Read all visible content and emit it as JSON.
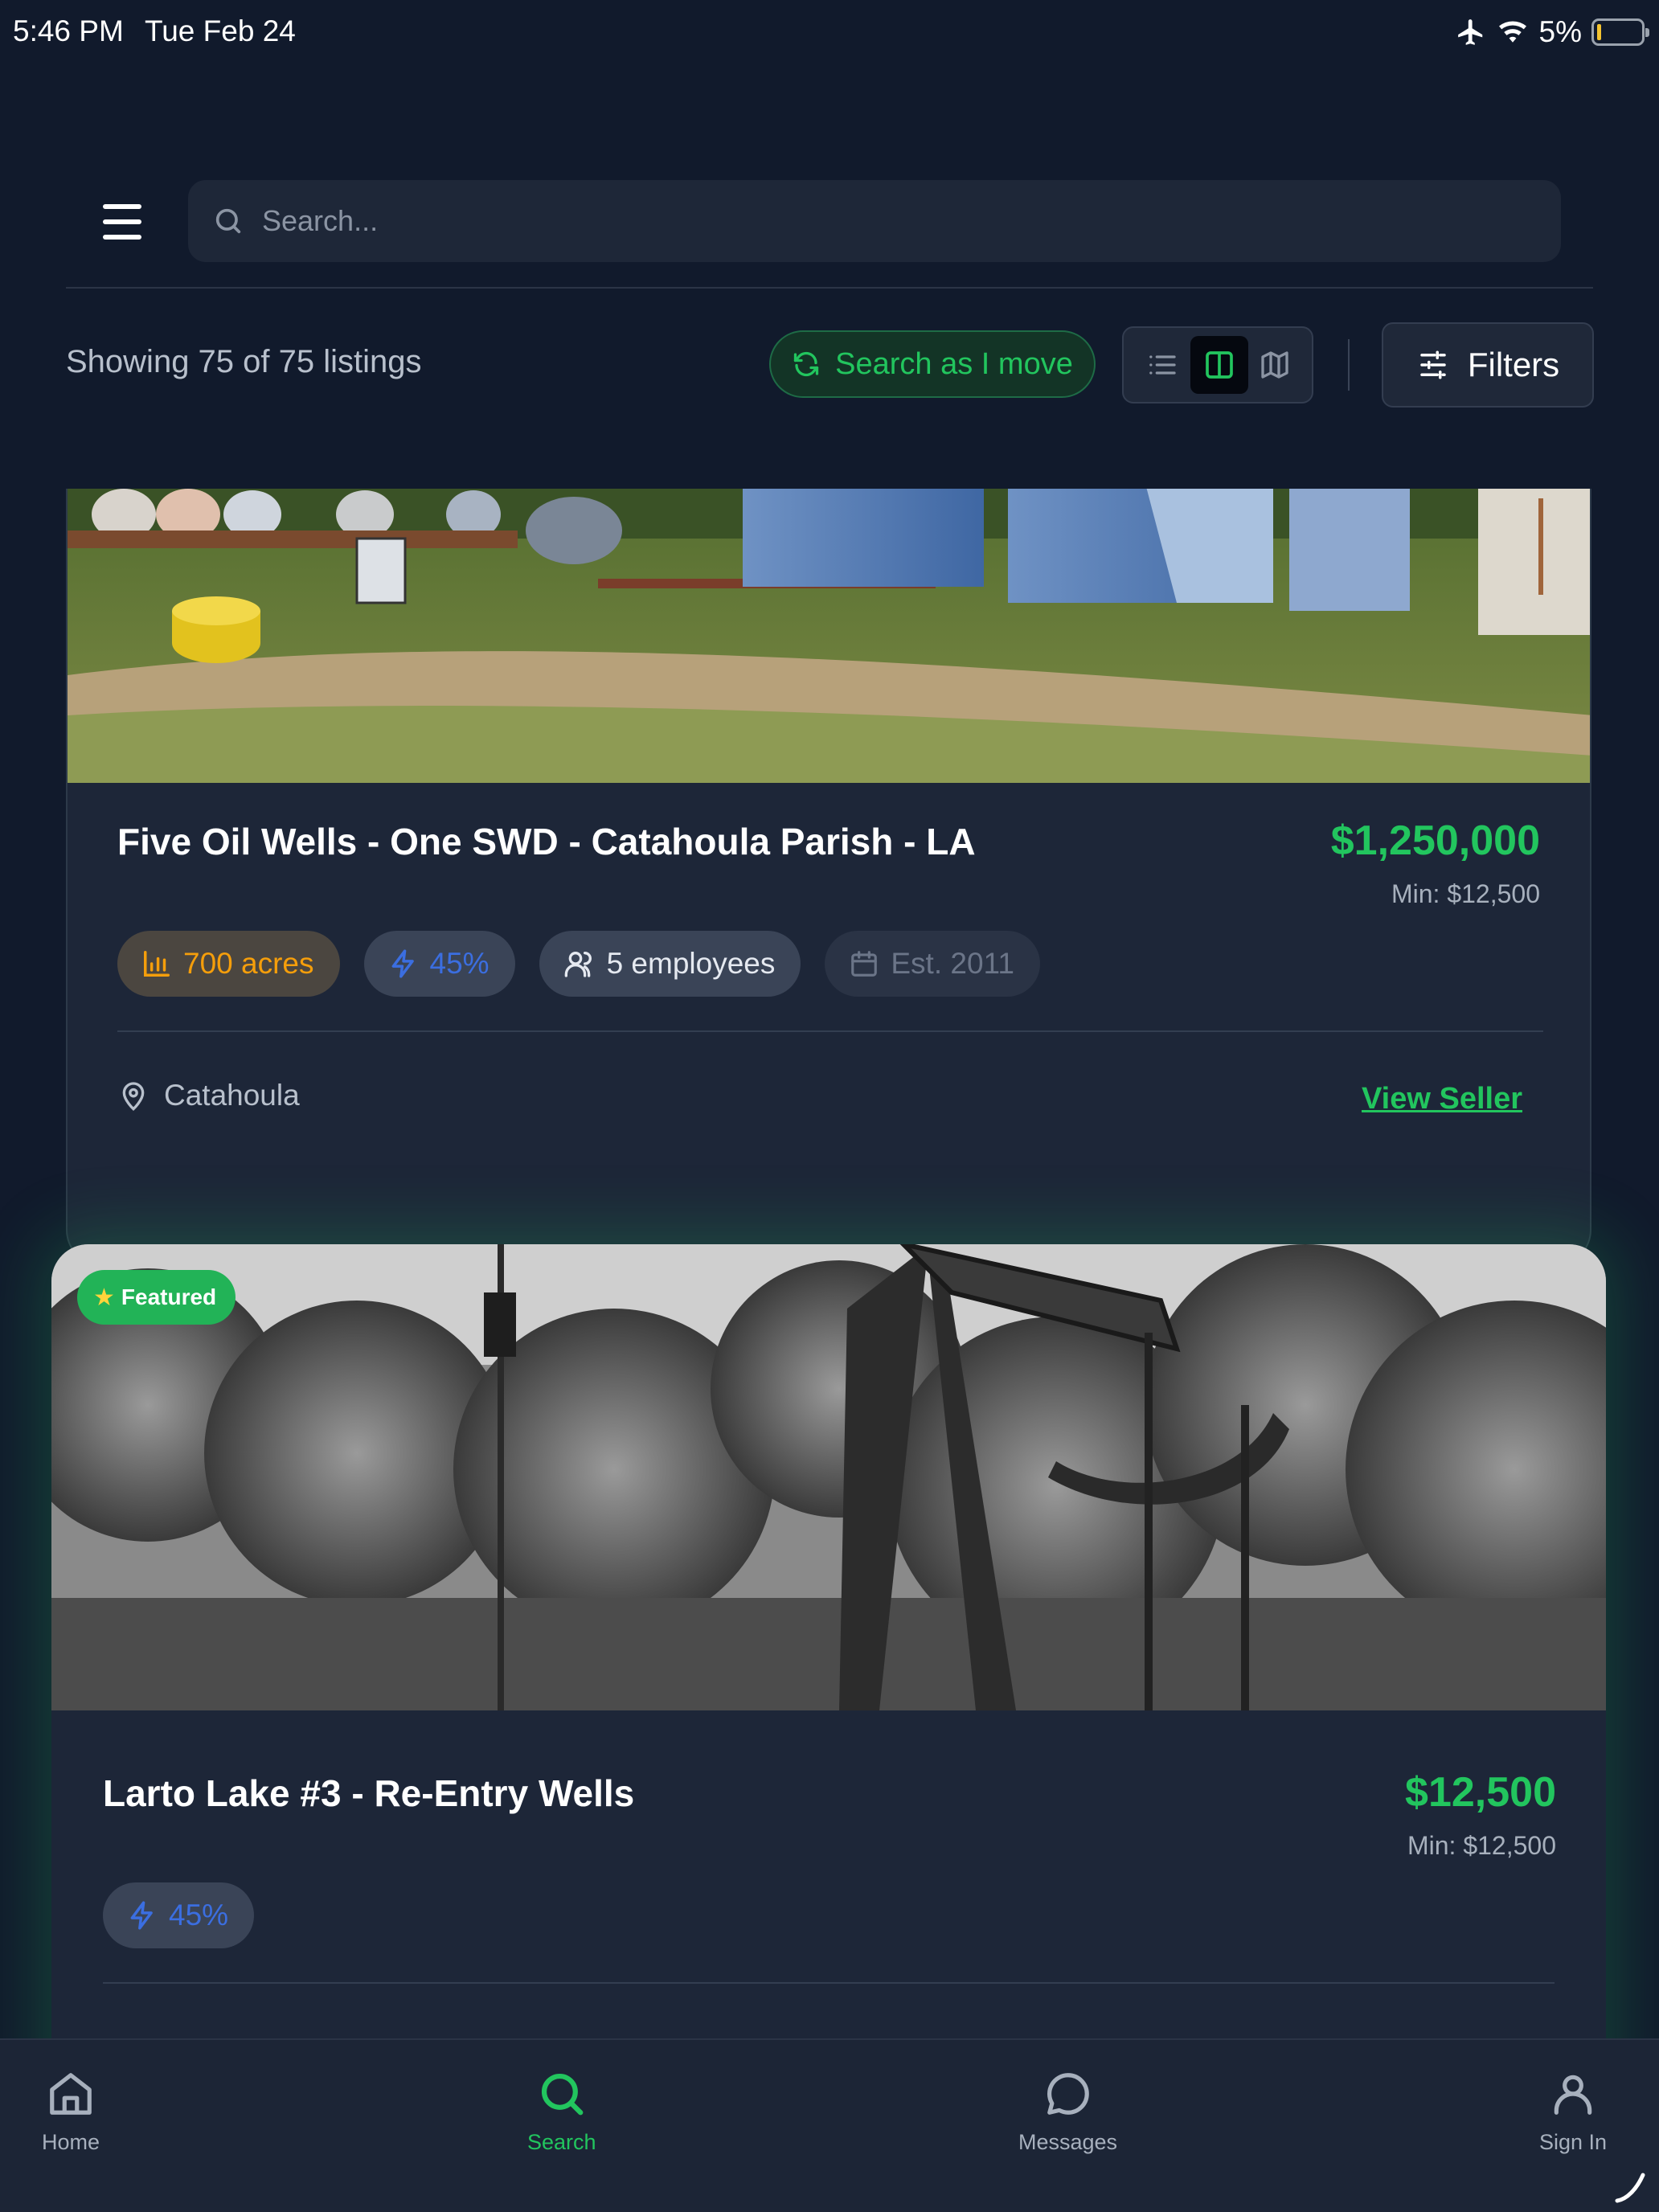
{
  "status_bar": {
    "time": "5:46 PM",
    "date": "Tue Feb 24",
    "battery": "5%"
  },
  "header": {
    "search_placeholder": "Search..."
  },
  "toolbar": {
    "showing": "Showing 75 of 75 listings",
    "search_as_i_move": "Search as I move",
    "filters": "Filters",
    "view_mode": "split"
  },
  "listings": [
    {
      "title": "Five Oil Wells - One SWD - Catahoula Parish - LA",
      "price": "$1,250,000",
      "min": "Min: $12,500",
      "tags": {
        "acres": "700 acres",
        "percent": "45%",
        "employees": "5 employees",
        "established": "Est. 2011"
      },
      "location": "Catahoula",
      "action": "View Seller"
    },
    {
      "badge": "Featured",
      "title": "Larto Lake #3 - Re-Entry Wells",
      "price": "$12,500",
      "min": "Min: $12,500",
      "tags": {
        "percent": "45%"
      }
    }
  ],
  "nav": {
    "home": "Home",
    "search": "Search",
    "messages": "Messages",
    "sign_in": "Sign In",
    "active": "search"
  },
  "colors": {
    "accent": "#22c55e",
    "background": "#111a2c",
    "card": "#1d2638",
    "acres": "#f59e0b",
    "percent": "#3b6ee0"
  }
}
